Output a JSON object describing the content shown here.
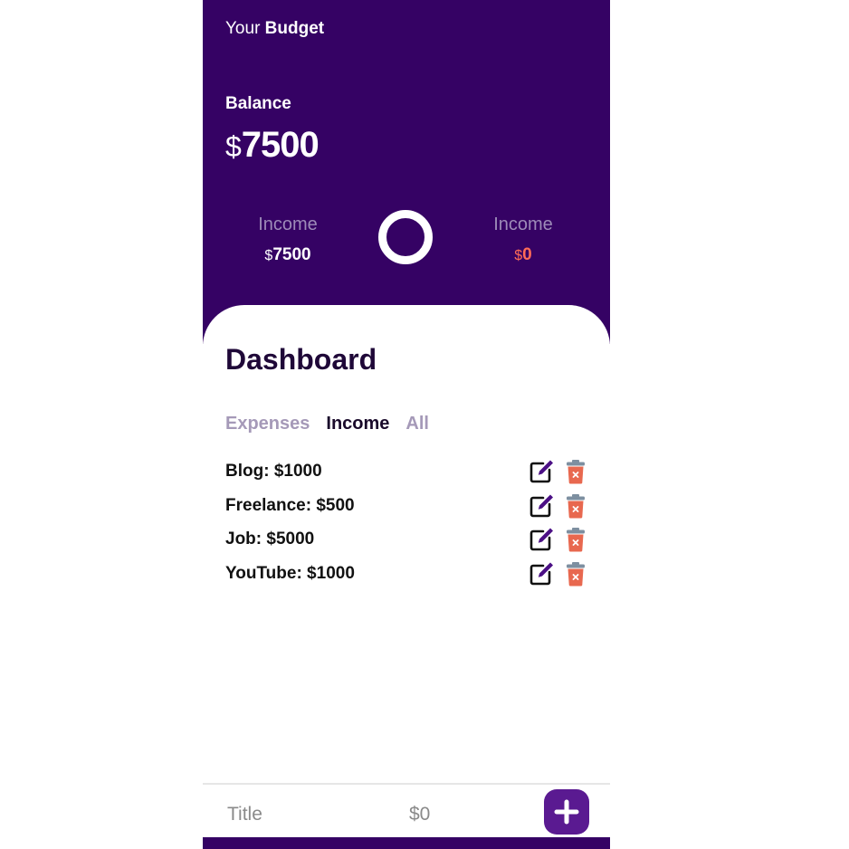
{
  "header": {
    "brand_prefix": "Your",
    "brand_bold": "Budget",
    "balance_label": "Balance",
    "balance_currency": "$",
    "balance_value": "7500",
    "income": {
      "label": "Income",
      "currency": "$",
      "value": "7500"
    },
    "expenses": {
      "label": "Income",
      "currency": "$",
      "value": "0"
    }
  },
  "dashboard": {
    "title": "Dashboard",
    "tabs": [
      {
        "label": "Expenses",
        "active": false
      },
      {
        "label": "Income",
        "active": true
      },
      {
        "label": "All",
        "active": false
      }
    ],
    "items": [
      {
        "text": "Blog: $1000"
      },
      {
        "text": "Freelance: $500"
      },
      {
        "text": "Job: $5000"
      },
      {
        "text": "YouTube: $1000"
      }
    ]
  },
  "form": {
    "title_placeholder": "Title",
    "amount_placeholder": "$0"
  },
  "colors": {
    "header_bg": "#350264",
    "expense_accent": "#ff6b57",
    "add_button": "#5a1a91",
    "delete_icon": "#e8684f"
  },
  "icons": {
    "edit": "edit-icon",
    "delete": "trash-icon",
    "add": "plus-icon"
  }
}
